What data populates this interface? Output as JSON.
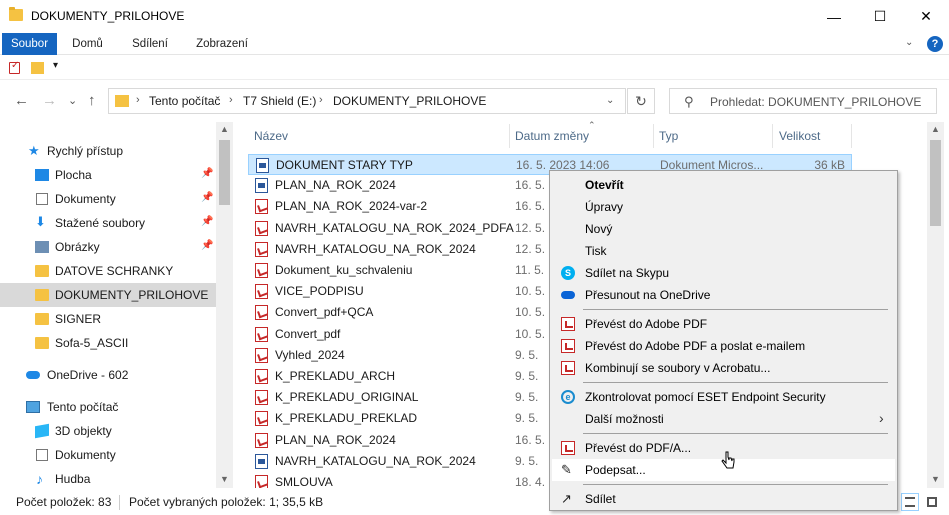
{
  "window": {
    "title": "DOKUMENTY_PRILOHOVE",
    "minimize": "—",
    "maximize": "☐",
    "close": "✕"
  },
  "ribbon": {
    "tabs": [
      "Soubor",
      "Domů",
      "Sdílení",
      "Zobrazení"
    ],
    "help": "?"
  },
  "nav": {
    "back": "←",
    "forward": "→",
    "recent": "⌄",
    "up": "↑",
    "path": [
      "Tento počítač",
      "T7 Shield (E:)",
      "DOKUMENTY_PRILOHOVE"
    ],
    "search_placeholder": "Prohledat: DOKUMENTY_PRILOHOVE"
  },
  "sidebar": {
    "items": [
      {
        "label": "Rychlý přístup",
        "icon": "star-icon"
      },
      {
        "label": "Plocha",
        "icon": "desktop-icon",
        "pinned": true
      },
      {
        "label": "Dokumenty",
        "icon": "documents-icon",
        "pinned": true
      },
      {
        "label": "Stažené soubory",
        "icon": "downloads-icon",
        "pinned": true
      },
      {
        "label": "Obrázky",
        "icon": "pictures-icon",
        "pinned": true
      },
      {
        "label": "DATOVE SCHRANKY",
        "icon": "folder-icon"
      },
      {
        "label": "DOKUMENTY_PRILOHOVE",
        "icon": "folder-icon",
        "selected": true
      },
      {
        "label": "SIGNER",
        "icon": "folder-icon"
      },
      {
        "label": "Sofa-5_ASCII",
        "icon": "folder-icon"
      },
      {
        "label": "OneDrive - 602",
        "icon": "onedrive-icon"
      },
      {
        "label": "Tento počítač",
        "icon": "computer-icon"
      },
      {
        "label": "3D objekty",
        "icon": "cube-icon"
      },
      {
        "label": "Dokumenty",
        "icon": "documents-icon"
      },
      {
        "label": "Hudba",
        "icon": "music-icon"
      }
    ]
  },
  "columns": {
    "name": "Název",
    "date": "Datum změny",
    "type": "Typ",
    "size": "Velikost"
  },
  "files": [
    {
      "name": "DOKUMENT STARY TYP",
      "date": "16. 5. 2023 14:06",
      "type": "Dokument Micros...",
      "size": "36 kB",
      "kind": "word",
      "selected": true
    },
    {
      "name": "PLAN_NA_ROK_2024",
      "date": "16. 5.",
      "type": "",
      "size": "",
      "kind": "word"
    },
    {
      "name": "PLAN_NA_ROK_2024-var-2",
      "date": "16. 5.",
      "type": "",
      "size": "",
      "kind": "pdf"
    },
    {
      "name": "NAVRH_KATALOGU_NA_ROK_2024_PDFA",
      "date": "12. 5.",
      "type": "",
      "size": "",
      "kind": "pdf"
    },
    {
      "name": "NAVRH_KATALOGU_NA_ROK_2024",
      "date": "12. 5.",
      "type": "",
      "size": "",
      "kind": "pdf"
    },
    {
      "name": "Dokument_ku_schvaleniu",
      "date": "11. 5.",
      "type": "",
      "size": "",
      "kind": "pdf"
    },
    {
      "name": "VICE_PODPISU",
      "date": "10. 5.",
      "type": "",
      "size": "",
      "kind": "pdf"
    },
    {
      "name": "Convert_pdf+QCA",
      "date": "10. 5.",
      "type": "",
      "size": "",
      "kind": "pdf"
    },
    {
      "name": "Convert_pdf",
      "date": "10. 5.",
      "type": "",
      "size": "",
      "kind": "pdf"
    },
    {
      "name": "Vyhled_2024",
      "date": "9. 5.",
      "type": "",
      "size": "",
      "kind": "pdf"
    },
    {
      "name": "K_PREKLADU_ARCH",
      "date": "9. 5.",
      "type": "",
      "size": "",
      "kind": "pdf"
    },
    {
      "name": "K_PREKLADU_ORIGINAL",
      "date": "9. 5.",
      "type": "",
      "size": "",
      "kind": "pdf"
    },
    {
      "name": "K_PREKLADU_PREKLAD",
      "date": "9. 5.",
      "type": "",
      "size": "",
      "kind": "pdf"
    },
    {
      "name": "PLAN_NA_ROK_2024",
      "date": "16. 5.",
      "type": "",
      "size": "",
      "kind": "pdf"
    },
    {
      "name": "NAVRH_KATALOGU_NA_ROK_2024",
      "date": "9. 5.",
      "type": "",
      "size": "",
      "kind": "word"
    },
    {
      "name": "SMLOUVA",
      "date": "18. 4.",
      "type": "",
      "size": "",
      "kind": "pdf"
    }
  ],
  "status": {
    "count": "Počet položek: 83",
    "selected": "Počet vybraných položek: 1; 35,5 kB"
  },
  "context_menu": {
    "items": [
      {
        "label": "Otevřít",
        "bold": true
      },
      {
        "label": "Úpravy"
      },
      {
        "label": "Nový"
      },
      {
        "label": "Tisk"
      },
      {
        "label": "Sdílet na Skypu",
        "icon": "skype-icon"
      },
      {
        "label": "Přesunout na OneDrive",
        "icon": "onedrive-icon"
      },
      {
        "label": "Převést do Adobe PDF",
        "icon": "adobe-pdf-icon"
      },
      {
        "label": "Převést do Adobe PDF a poslat e-mailem",
        "icon": "adobe-pdf-mail-icon"
      },
      {
        "label": "Kombinují se soubory v Acrobatu...",
        "icon": "acrobat-combine-icon"
      },
      {
        "label": "Zkontrolovat pomocí ESET Endpoint Security",
        "icon": "eset-icon"
      },
      {
        "label": "Další možnosti",
        "submenu": true
      },
      {
        "label": "Převést do PDF/A...",
        "icon": "pdfa-icon"
      },
      {
        "label": "Podepsat...",
        "icon": "pen-icon",
        "hover": true
      },
      {
        "label": "Sdílet",
        "icon": "share-icon"
      }
    ]
  }
}
